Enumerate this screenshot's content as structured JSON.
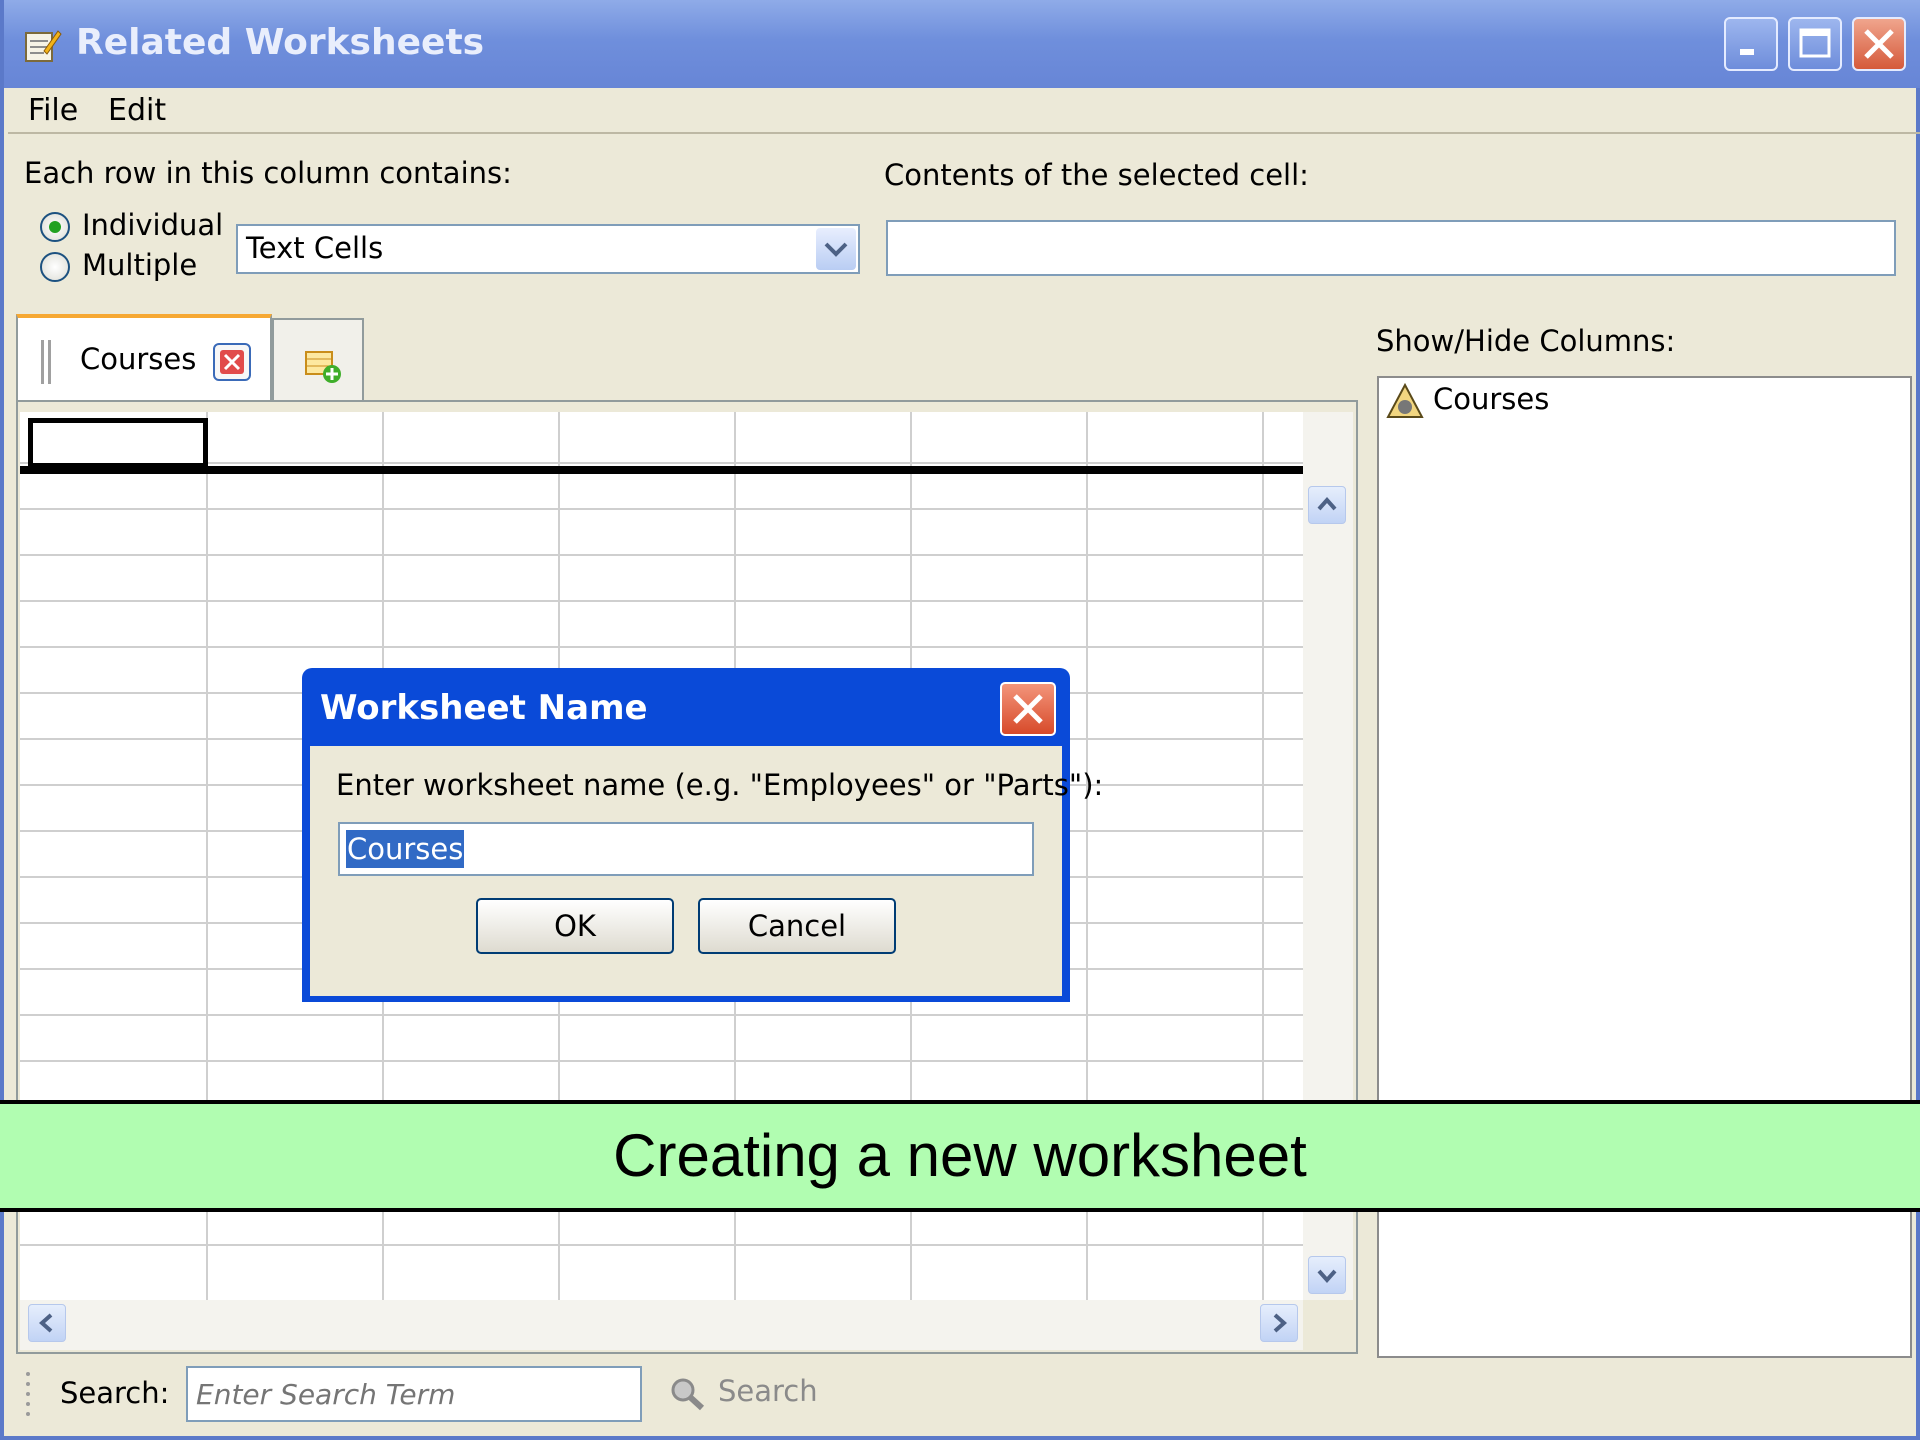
{
  "window": {
    "title": "Related Worksheets"
  },
  "menu": {
    "file": "File",
    "edit": "Edit"
  },
  "form": {
    "row_contains_label": "Each row in this column contains:",
    "radio_individual": "Individual",
    "radio_multiple": "Multiple",
    "selected_type": "Text Cells",
    "contents_label": "Contents of the selected cell:",
    "contents_value": ""
  },
  "tabs": {
    "active_tab": "Courses"
  },
  "columns_panel": {
    "label": "Show/Hide Columns:",
    "items": [
      "Courses"
    ]
  },
  "dialog": {
    "title": "Worksheet Name",
    "prompt": "Enter worksheet name (e.g. \"Employees\" or \"Parts\"):",
    "value": "Courses",
    "ok": "OK",
    "cancel": "Cancel"
  },
  "banner": {
    "text": "Creating a new worksheet"
  },
  "search": {
    "label": "Search:",
    "placeholder": "Enter Search Term",
    "button": "Search"
  },
  "colors": {
    "titlebar": "#6f8fdc",
    "dialog_title": "#0a4ad8",
    "banner": "#b1fdb1",
    "face": "#ece9d8"
  },
  "icons": [
    "app-icon",
    "minimize-icon",
    "maximize-icon",
    "close-icon",
    "dropdown-arrow-icon",
    "tab-grip-icon",
    "tab-close-icon",
    "add-worksheet-icon",
    "column-icon",
    "scroll-up-icon",
    "scroll-down-icon",
    "scroll-left-icon",
    "scroll-right-icon",
    "magnifier-icon"
  ]
}
